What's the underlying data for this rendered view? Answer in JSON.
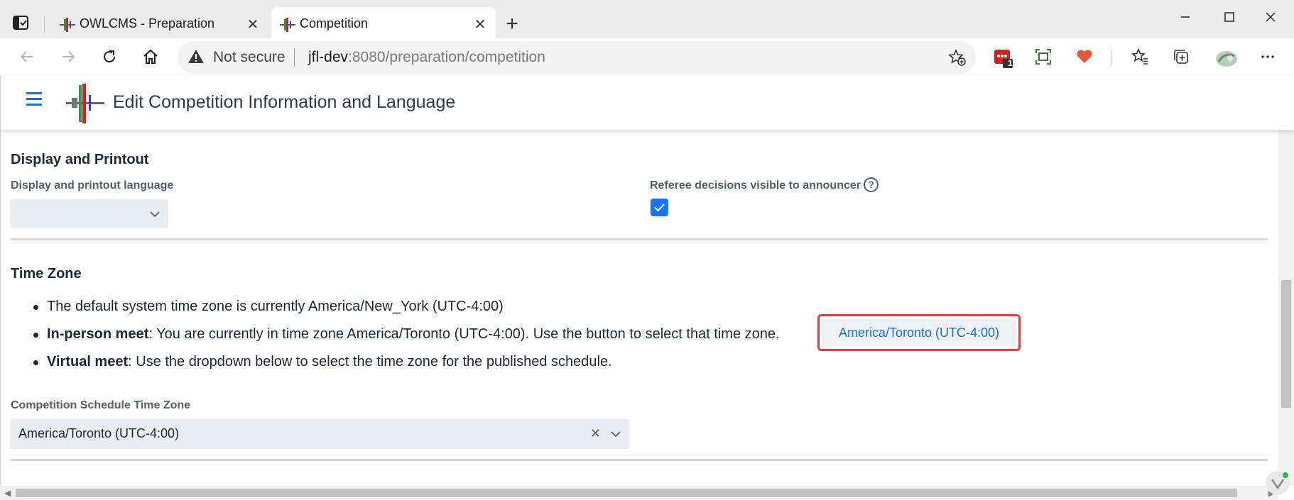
{
  "browser": {
    "tabs": [
      {
        "title": "OWLCMS - Preparation",
        "active": false
      },
      {
        "title": "Competition",
        "active": true
      }
    ],
    "address": {
      "security_text": "Not secure",
      "url_host": "jfl-dev",
      "url_rest": ":8080/preparation/competition"
    },
    "extension_badge": "1"
  },
  "app": {
    "title": "Edit Competition Information and Language"
  },
  "display_section": {
    "heading": "Display and Printout",
    "language_label": "Display and printout language",
    "language_value": "",
    "referee_label": "Referee decisions visible to announcer",
    "help_glyph": "?",
    "referee_checked": true
  },
  "timezone_section": {
    "heading": "Time Zone",
    "bullet_default": "The default system time zone is currently America/New_York (UTC-4:00)",
    "bullet_inperson_bold": "In-person meet",
    "bullet_inperson_text": ": You are currently in time zone America/Toronto (UTC-4:00). Use the button to select that time zone.",
    "bullet_virtual_bold": "Virtual meet",
    "bullet_virtual_text": ": Use the dropdown below to select the time zone for the published schedule.",
    "button_label": "America/Toronto (UTC-4:00)",
    "schedule_label": "Competition Schedule Time Zone",
    "schedule_value": "America/Toronto (UTC-4:00)",
    "clear_glyph": "✕"
  },
  "colors": {
    "accent": "#1a6fe0",
    "highlight_frame": "#e33a3a",
    "checkbox": "#1676f3"
  }
}
